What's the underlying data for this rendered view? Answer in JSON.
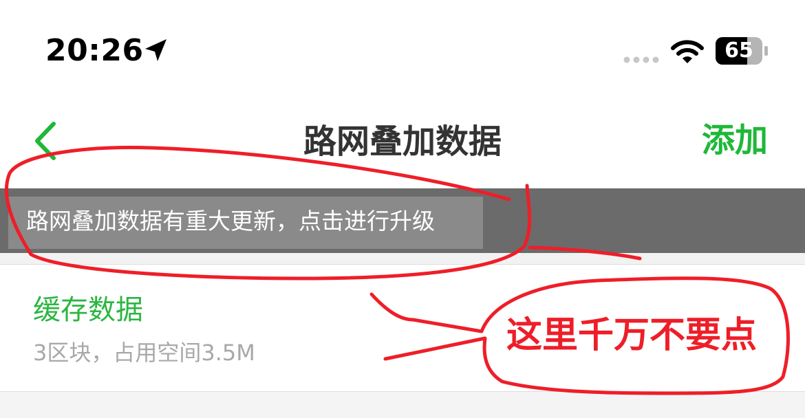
{
  "status_bar": {
    "time": "20:26",
    "battery_level": "65",
    "icons": [
      "location-arrow-icon",
      "signal-dots-icon",
      "wifi-icon",
      "battery-icon"
    ]
  },
  "nav": {
    "title": "路网叠加数据",
    "add_label": "添加",
    "back_icon": "chevron-left-icon"
  },
  "update_banner": {
    "text": "路网叠加数据有重大更新，点击进行升级"
  },
  "cache_item": {
    "title": "缓存数据",
    "subtitle": "3区块，占用空间3.5M"
  },
  "annotation": {
    "text": "这里千万不要点"
  },
  "colors": {
    "accent_green": "#1eb838",
    "banner_bg": "#6b6b6b",
    "annotation_red": "#ee1e28"
  }
}
